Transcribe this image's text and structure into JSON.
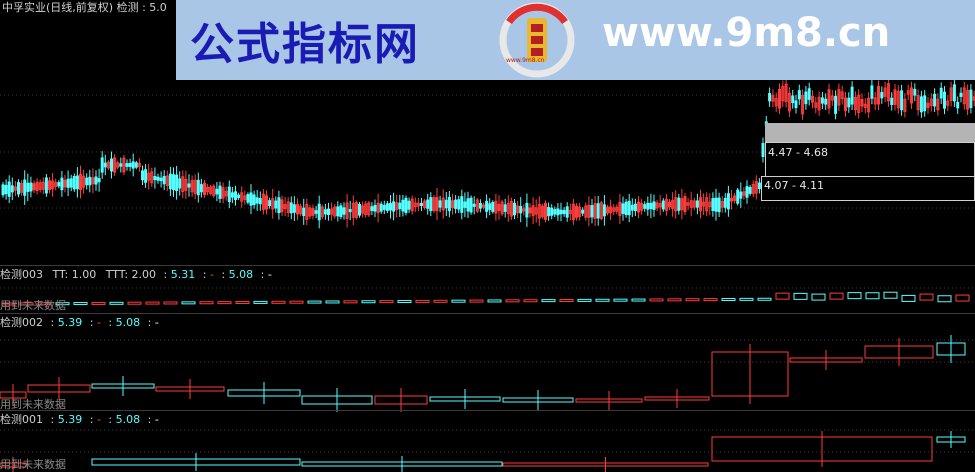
{
  "main_chart": {
    "title": "中孚实业(日线,前复权) 检测",
    "title_value": "5.0"
  },
  "watermark": {
    "left_text": "公式指标网",
    "right_text": "www.9m8.cn",
    "seal_text": "www.9m8.cn"
  },
  "popups": [
    {
      "text": "4.47 - 4.68"
    },
    {
      "text": "4.07 - 4.11"
    }
  ],
  "panels": [
    {
      "name": "检测003",
      "items": [
        {
          "label": "TT:",
          "value": "1.00"
        },
        {
          "label": "TTT:",
          "value": "2.00"
        },
        {
          "label": ":",
          "value": "5.31"
        },
        {
          "label": ":",
          "value": "-"
        },
        {
          "label": ":",
          "value": "5.08"
        },
        {
          "label": ":",
          "value": "-"
        }
      ],
      "footer": "用到未来数据"
    },
    {
      "name": "检测002",
      "items": [
        {
          "label": ":",
          "value": "5.39"
        },
        {
          "label": ":",
          "value": "-"
        },
        {
          "label": ":",
          "value": "5.08"
        },
        {
          "label": ":",
          "value": "-"
        }
      ],
      "footer": "用到未来数据"
    },
    {
      "name": "检测001",
      "items": [
        {
          "label": ":",
          "value": "5.39"
        },
        {
          "label": ":",
          "value": "-"
        },
        {
          "label": ":",
          "value": "5.08"
        },
        {
          "label": ":",
          "value": "-"
        }
      ],
      "footer": "用到未来数据"
    }
  ],
  "colors": {
    "up": "#ff3c3c",
    "down": "#54ffff",
    "text": "#d0d0d0",
    "value": "#54ffff",
    "dash": "#ff5050",
    "grid": "#2a2a2a"
  }
}
